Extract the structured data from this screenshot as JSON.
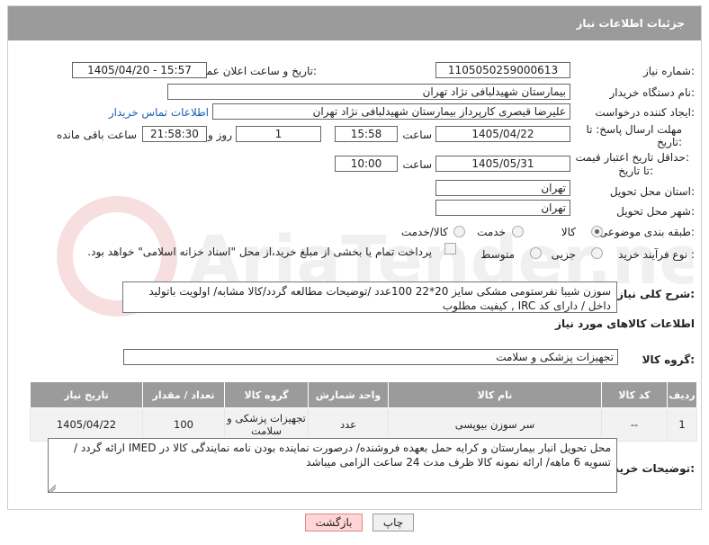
{
  "header": {
    "title": "جزئیات اطلاعات نیاز"
  },
  "form": {
    "need_number": {
      "label": "شماره نیاز:",
      "value": "1105050259000613"
    },
    "announce_datetime": {
      "label": "تاریخ و ساعت اعلان عمومی:",
      "value": "1405/04/20 - 15:57"
    },
    "buyer_org": {
      "label": "نام دستگاه خریدار:",
      "value": "بیمارستان شهیدلبافی نژاد تهران"
    },
    "requester": {
      "label": "ایجاد کننده درخواست:",
      "value": "علیرضا قیصری کارپرداز بیمارستان شهیدلبافی نژاد تهران",
      "contact_link": "اطلاعات تماس خریدار"
    },
    "reply_deadline": {
      "label_line1": "مهلت ارسال پاسخ: تا",
      "label_line2": "تاریخ:",
      "date": "1405/04/22",
      "time_label": "ساعت",
      "time": "15:58",
      "days": "1",
      "days_label": "روز و",
      "remaining": "21:58:30",
      "remaining_label": "ساعت باقی مانده"
    },
    "price_validity": {
      "label_line1": "حداقل تاریخ اعتبار قیمت:",
      "label_line2": "تا تاریخ:",
      "date": "1405/05/31",
      "time_label": "ساعت",
      "time": "10:00"
    },
    "province": {
      "label": "استان محل تحویل:",
      "value": "تهران"
    },
    "city": {
      "label": "شهر محل تحویل:",
      "value": "تهران"
    },
    "category": {
      "label": "طبقه بندی موضوعی:",
      "options": [
        "کالا",
        "خدمت",
        "کالا/خدمت"
      ],
      "selected": "کالا"
    },
    "purchase_process": {
      "label": "نوع فرآیند خرید :",
      "options": [
        "جزیی",
        "متوسط"
      ],
      "note": "پرداخت تمام یا بخشی از مبلغ خرید،از محل \"اسناد خزانه اسلامی\" خواهد بود."
    },
    "description": {
      "label": "شرح کلی نیاز:",
      "value": "سوزن شیبا نفرستومی مشکی سایز 20*22  100عدد /توضیحات مطالعه گردد/کالا مشابه/ اولویت باتولید داخل / دارای کد IRC , کیفیت مطلوب"
    }
  },
  "goods_section": {
    "title": "اطلاعات کالاهای مورد نیاز",
    "group_label": "گروه کالا:",
    "group_value": "تجهیزات پزشکی و سلامت",
    "table": {
      "headers": [
        "ردیف",
        "کد کالا",
        "نام کالا",
        "واحد شمارش",
        "گروه کالا",
        "تعداد / مقدار",
        "تاریخ نیاز"
      ],
      "rows": [
        [
          "1",
          "--",
          "سر سوزن بیوپسی",
          "عدد",
          "تجهیزات پزشکی و سلامت",
          "100",
          "1405/04/22"
        ]
      ]
    }
  },
  "buyer_notes": {
    "label": "توضیحات خریدار:",
    "value": "محل تحویل انبار بیمارستان و کرایه حمل بعهده فروشنده/ درصورت نماینده بودن نامه نمایندگی کالا در  IMED ارائه گردد / تسویه 6 ماهه/ ارائه نمونه کالا ظرف مدت 24 ساعت الزامی میباشد"
  },
  "buttons": {
    "print": "چاپ",
    "back": "بازگشت"
  },
  "watermark": {
    "text": "AriaTender.net"
  },
  "colors": {
    "header_bg": "#9b9b9b",
    "link": "#1a5fb4",
    "back_button": "#ffd5d5"
  }
}
